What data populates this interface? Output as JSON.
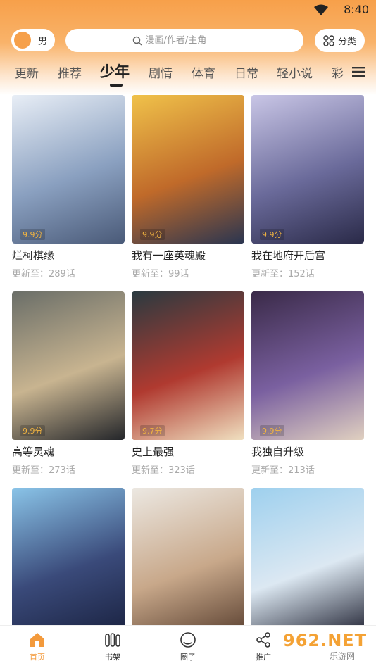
{
  "status_bar": {
    "time": "8:40"
  },
  "header": {
    "gender_label": "男",
    "search_placeholder": "漫画/作者/主角",
    "category_label": "分类"
  },
  "tabs": [
    "更新",
    "推荐",
    "少年",
    "剧情",
    "体育",
    "日常",
    "轻小说",
    "彩"
  ],
  "active_tab": "少年",
  "comics": [
    {
      "title": "烂柯棋缘",
      "rating": "9.9分",
      "update": "更新至：289话",
      "cover_colors": [
        "#e8eef6",
        "#8aa0c0",
        "#4a5a78"
      ]
    },
    {
      "title": "我有一座英魂殿",
      "rating": "9.9分",
      "update": "更新至：99话",
      "cover_colors": [
        "#f0c24a",
        "#c06a2a",
        "#2a3550"
      ]
    },
    {
      "title": "我在地府开后宫",
      "rating": "9.9分",
      "update": "更新至：152话",
      "cover_colors": [
        "#c9c6e6",
        "#6a6a9a",
        "#2a2a48"
      ]
    },
    {
      "title": "高等灵魂",
      "rating": "9.9分",
      "update": "更新至：273话",
      "cover_colors": [
        "#6a6e68",
        "#c8b490",
        "#24262a"
      ]
    },
    {
      "title": "史上最强",
      "rating": "9.7分",
      "update": "更新至：323话",
      "cover_colors": [
        "#2a3a40",
        "#b03a30",
        "#f0e0c0"
      ]
    },
    {
      "title": "我独自升级",
      "rating": "9.9分",
      "update": "更新至：213话",
      "cover_colors": [
        "#3a2a48",
        "#7a60a0",
        "#e0d0c0"
      ]
    },
    {
      "title": "",
      "rating": "",
      "update": "",
      "cover_colors": [
        "#8ac4e8",
        "#3a4a7a",
        "#1a2240"
      ]
    },
    {
      "title": "",
      "rating": "",
      "update": "",
      "cover_colors": [
        "#ece8e2",
        "#c8a88a",
        "#5a4030"
      ]
    },
    {
      "title": "",
      "rating": "",
      "update": "",
      "cover_colors": [
        "#9ed0ee",
        "#dce8f2",
        "#1e2030"
      ]
    }
  ],
  "bottom_nav": [
    {
      "label": "首页",
      "icon": "home-icon",
      "active": true
    },
    {
      "label": "书架",
      "icon": "bookshelf-icon",
      "active": false
    },
    {
      "label": "圈子",
      "icon": "circle-icon",
      "active": false
    },
    {
      "label": "推广",
      "icon": "share-icon",
      "active": false
    }
  ],
  "watermark": {
    "main": "962.NET",
    "sub": "乐游网"
  },
  "colors": {
    "accent": "#f39a3c",
    "header_gradient_top": "#f7a04a",
    "rating": "#f2b440"
  }
}
